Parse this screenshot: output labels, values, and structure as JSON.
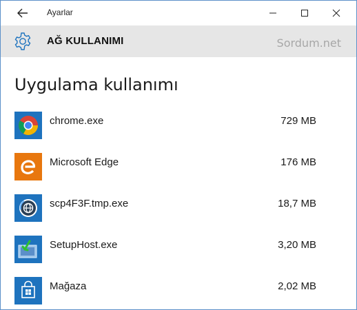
{
  "window": {
    "title": "Ayarlar"
  },
  "header": {
    "title": "AĞ KULLANIMI",
    "watermark": "Sordum.net"
  },
  "main": {
    "section_title": "Uygulama kullanımı",
    "apps": [
      {
        "name": "chrome.exe",
        "size": "729 MB",
        "icon": "chrome-icon"
      },
      {
        "name": "Microsoft Edge",
        "size": "176 MB",
        "icon": "edge-icon"
      },
      {
        "name": "scp4F3F.tmp.exe",
        "size": "18,7 MB",
        "icon": "network-globe-icon"
      },
      {
        "name": "SetupHost.exe",
        "size": "3,20 MB",
        "icon": "setup-host-icon"
      },
      {
        "name": "Mağaza",
        "size": "2,02 MB",
        "icon": "store-icon"
      }
    ]
  },
  "colors": {
    "header_bg": "#e6e6e6",
    "accent_blue": "#1e73be",
    "edge_orange": "#e8770e"
  }
}
